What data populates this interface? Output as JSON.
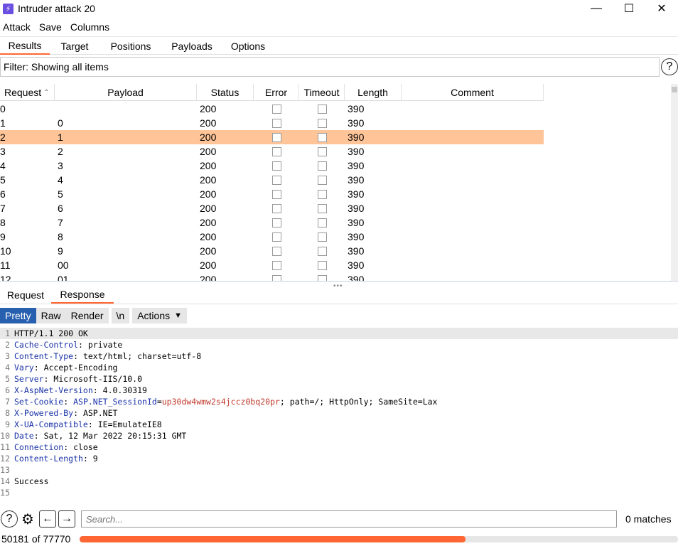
{
  "window": {
    "title": "Intruder attack 20",
    "icon": "bolt-icon",
    "accent": "#6b4fe0"
  },
  "menu": [
    {
      "label": "Attack"
    },
    {
      "label": "Save"
    },
    {
      "label": "Columns"
    }
  ],
  "main_tabs": [
    {
      "label": "Results",
      "active": true
    },
    {
      "label": "Target",
      "active": false
    },
    {
      "label": "Positions",
      "active": false
    },
    {
      "label": "Payloads",
      "active": false
    },
    {
      "label": "Options",
      "active": false
    }
  ],
  "filter": {
    "text": "Filter: Showing all items"
  },
  "table": {
    "columns": [
      {
        "label": "Request",
        "sort": "ascending"
      },
      {
        "label": "Payload"
      },
      {
        "label": "Status"
      },
      {
        "label": "Error"
      },
      {
        "label": "Timeout"
      },
      {
        "label": "Length"
      },
      {
        "label": "Comment"
      }
    ],
    "selected_row": 2,
    "rows": [
      {
        "request": "0",
        "payload": "",
        "status": "200",
        "error": false,
        "timeout": false,
        "length": "390",
        "comment": ""
      },
      {
        "request": "1",
        "payload": "0",
        "status": "200",
        "error": false,
        "timeout": false,
        "length": "390",
        "comment": ""
      },
      {
        "request": "2",
        "payload": "1",
        "status": "200",
        "error": false,
        "timeout": false,
        "length": "390",
        "comment": ""
      },
      {
        "request": "3",
        "payload": "2",
        "status": "200",
        "error": false,
        "timeout": false,
        "length": "390",
        "comment": ""
      },
      {
        "request": "4",
        "payload": "3",
        "status": "200",
        "error": false,
        "timeout": false,
        "length": "390",
        "comment": ""
      },
      {
        "request": "5",
        "payload": "4",
        "status": "200",
        "error": false,
        "timeout": false,
        "length": "390",
        "comment": ""
      },
      {
        "request": "6",
        "payload": "5",
        "status": "200",
        "error": false,
        "timeout": false,
        "length": "390",
        "comment": ""
      },
      {
        "request": "7",
        "payload": "6",
        "status": "200",
        "error": false,
        "timeout": false,
        "length": "390",
        "comment": ""
      },
      {
        "request": "8",
        "payload": "7",
        "status": "200",
        "error": false,
        "timeout": false,
        "length": "390",
        "comment": ""
      },
      {
        "request": "9",
        "payload": "8",
        "status": "200",
        "error": false,
        "timeout": false,
        "length": "390",
        "comment": ""
      },
      {
        "request": "10",
        "payload": "9",
        "status": "200",
        "error": false,
        "timeout": false,
        "length": "390",
        "comment": ""
      },
      {
        "request": "11",
        "payload": "00",
        "status": "200",
        "error": false,
        "timeout": false,
        "length": "390",
        "comment": ""
      },
      {
        "request": "12",
        "payload": "01",
        "status": "200",
        "error": false,
        "timeout": false,
        "length": "390",
        "comment": ""
      }
    ]
  },
  "lower_tabs": [
    {
      "label": "Request",
      "active": false
    },
    {
      "label": "Response",
      "active": true
    }
  ],
  "view_buttons": {
    "pretty": "Pretty",
    "raw": "Raw",
    "render": "Render",
    "newline": "\\n",
    "actions": "Actions"
  },
  "response_lines": [
    {
      "n": "1",
      "name": "",
      "sep": "",
      "value": "HTTP/1.1 200 OK"
    },
    {
      "n": "2",
      "name": "Cache-Control",
      "sep": ": ",
      "value": "private"
    },
    {
      "n": "3",
      "name": "Content-Type",
      "sep": ": ",
      "value": "text/html; charset=utf-8"
    },
    {
      "n": "4",
      "name": "Vary",
      "sep": ": ",
      "value": "Accept-Encoding"
    },
    {
      "n": "5",
      "name": "Server",
      "sep": ": ",
      "value": "Microsoft-IIS/10.0"
    },
    {
      "n": "6",
      "name": "X-AspNet-Version",
      "sep": ": ",
      "value": "4.0.30319"
    },
    {
      "n": "7",
      "name": "Set-Cookie",
      "sep": ": ",
      "value": "; path=/; HttpOnly; SameSite=Lax",
      "cookie_name": "ASP.NET_SessionId",
      "cookie_value": "up30dw4wmw2s4jccz0bq20pr"
    },
    {
      "n": "8",
      "name": "X-Powered-By",
      "sep": ": ",
      "value": "ASP.NET"
    },
    {
      "n": "9",
      "name": "X-UA-Compatible",
      "sep": ": ",
      "value": "IE=EmulateIE8"
    },
    {
      "n": "10",
      "name": "Date",
      "sep": ": ",
      "value": "Sat, 12 Mar 2022 20:15:31 GMT"
    },
    {
      "n": "11",
      "name": "Connection",
      "sep": ": ",
      "value": "close"
    },
    {
      "n": "12",
      "name": "Content-Length",
      "sep": ": ",
      "value": "9"
    },
    {
      "n": "13",
      "name": "",
      "sep": "",
      "value": ""
    },
    {
      "n": "14",
      "name": "",
      "sep": "",
      "value": "Success"
    },
    {
      "n": "15",
      "name": "",
      "sep": "",
      "value": ""
    }
  ],
  "search": {
    "placeholder": "Search...",
    "matches": "0 matches"
  },
  "progress": {
    "label": "50181 of 77770",
    "done": 50181,
    "total": 77770,
    "color": "#ff6633"
  },
  "colors": {
    "selected_row": "#ffc599",
    "tab_accent": "#ff6633",
    "active_view": "#2860b0",
    "header_name": "#1a33a8",
    "cookie_value": "#c0392b"
  }
}
